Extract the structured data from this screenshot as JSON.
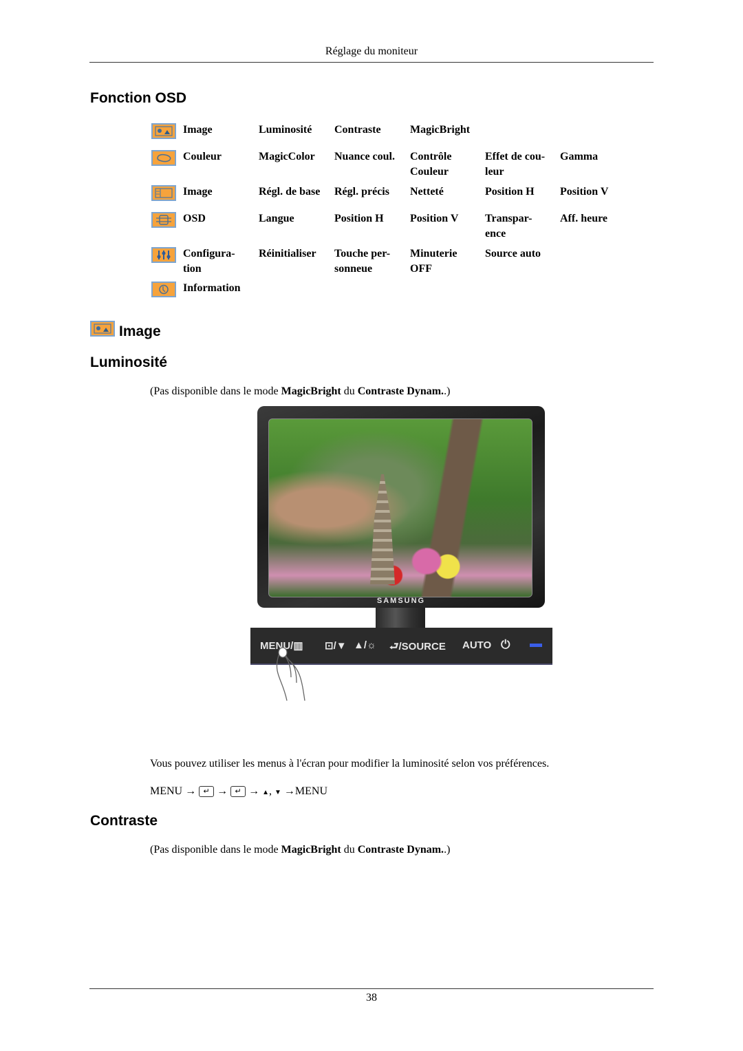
{
  "header": {
    "running_title": "Réglage du moniteur"
  },
  "section_title": "Fonction OSD",
  "osd_menu": [
    {
      "icon": "picture-icon",
      "items": [
        "Image",
        "Luminosité",
        "Contraste",
        "MagicBright",
        "",
        ""
      ]
    },
    {
      "icon": "color-palette-icon",
      "items": [
        "Couleur",
        "MagicColor",
        "Nuance coul.",
        "Contrôle Couleur",
        "Effet de cou-leur",
        "Gamma"
      ]
    },
    {
      "icon": "image-geometry-icon",
      "items": [
        "Image",
        "Régl. de base",
        "Régl. précis",
        "Netteté",
        "Position H",
        "Position V"
      ]
    },
    {
      "icon": "osd-icon",
      "items": [
        "OSD",
        "Langue",
        "Position H",
        "Position V",
        "Transpar-ence",
        "Aff. heure"
      ]
    },
    {
      "icon": "settings-sliders-icon",
      "items": [
        "Configura-tion",
        "Réinitialiser",
        "Touche per-sonneue",
        "Minuterie OFF",
        "Source auto",
        ""
      ]
    },
    {
      "icon": "information-clock-icon",
      "items": [
        "Information",
        "",
        "",
        "",
        "",
        ""
      ]
    }
  ],
  "osd_menu_display": [
    [
      "Image",
      "Luminosité",
      "Contraste",
      "MagicBright",
      "",
      ""
    ],
    [
      "Couleur",
      "MagicColor",
      "Nuance coul.",
      "Contrôle\nCouleur",
      "Effet de cou-\nleur",
      "Gamma"
    ],
    [
      "Image",
      "Régl. de base",
      "Régl. précis",
      "Netteté",
      "Position H",
      "Position V"
    ],
    [
      "OSD",
      "Langue",
      "Position H",
      "Position V",
      "Transpar-\nence",
      "Aff. heure"
    ],
    [
      "Configura-\ntion",
      "Réinitialiser",
      "Touche per-\nsonneue",
      "Minuterie\nOFF",
      "Source auto",
      ""
    ],
    [
      "Information",
      "",
      "",
      "",
      "",
      ""
    ]
  ],
  "subsection": {
    "title": "Image",
    "icon": "picture-icon"
  },
  "luminosite": {
    "title": "Luminosité",
    "note_prefix": "(Pas disponible dans le mode ",
    "note_bold1": "MagicBright",
    "note_mid": " du ",
    "note_bold2": "Contraste Dynam.",
    "note_suffix": ".)",
    "description": "Vous pouvez utiliser les menus à l'écran pour modifier la luminosité selon vos préférences.",
    "sequence": {
      "start": "MENU",
      "arrow": "→",
      "enter_symbol": "↵",
      "up": "▲",
      "comma": ",",
      "down": "▼",
      "end": "MENU"
    }
  },
  "monitor_illustration": {
    "brand": "SAMSUNG",
    "buttons": [
      "MENU/▥",
      "⊡/▼",
      "▲/☼",
      "⮐/SOURCE",
      "AUTO",
      "⏻"
    ]
  },
  "contraste": {
    "title": "Contraste",
    "note_prefix": "(Pas disponible dans le mode ",
    "note_bold1": "MagicBright",
    "note_mid": " du ",
    "note_bold2": "Contraste Dynam.",
    "note_suffix": ".)"
  },
  "footer": {
    "page_number": "38"
  }
}
